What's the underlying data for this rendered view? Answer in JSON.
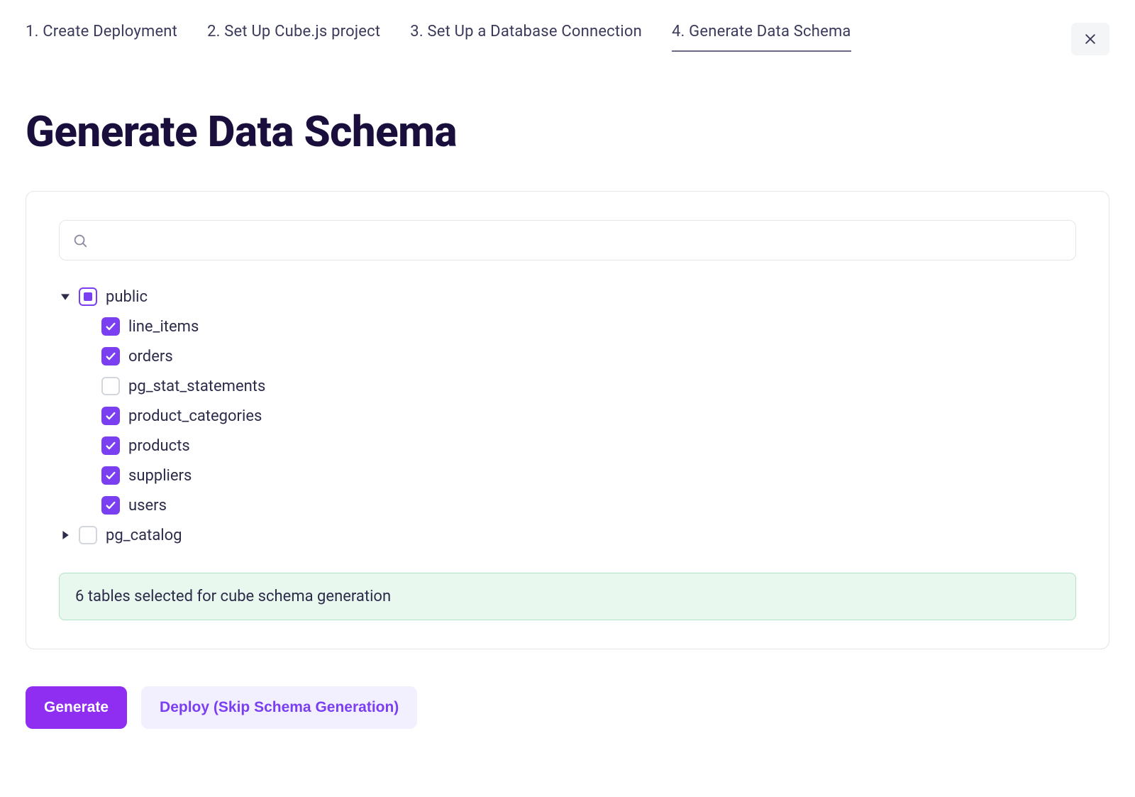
{
  "steps": [
    {
      "label": "1. Create Deployment",
      "active": false
    },
    {
      "label": "2. Set Up Cube.js project",
      "active": false
    },
    {
      "label": "3. Set Up a Database Connection",
      "active": false
    },
    {
      "label": "4. Generate Data Schema",
      "active": true
    }
  ],
  "page_title": "Generate Data Schema",
  "search": {
    "value": "",
    "placeholder": ""
  },
  "schemas": [
    {
      "name": "public",
      "expanded": true,
      "state": "indeterminate",
      "tables": [
        {
          "name": "line_items",
          "checked": true
        },
        {
          "name": "orders",
          "checked": true
        },
        {
          "name": "pg_stat_statements",
          "checked": false
        },
        {
          "name": "product_categories",
          "checked": true
        },
        {
          "name": "products",
          "checked": true
        },
        {
          "name": "suppliers",
          "checked": true
        },
        {
          "name": "users",
          "checked": true
        }
      ]
    },
    {
      "name": "pg_catalog",
      "expanded": false,
      "state": "unchecked",
      "tables": []
    }
  ],
  "status_message": "6 tables selected for cube schema generation",
  "buttons": {
    "generate": "Generate",
    "skip": "Deploy (Skip Schema Generation)"
  },
  "colors": {
    "accent": "#7b3ff2",
    "primary_button": "#8f2df0",
    "secondary_button_bg": "#f2efff",
    "status_bg": "#e9f8ef",
    "status_border": "#b2e2c4",
    "title": "#1a0f3c"
  }
}
